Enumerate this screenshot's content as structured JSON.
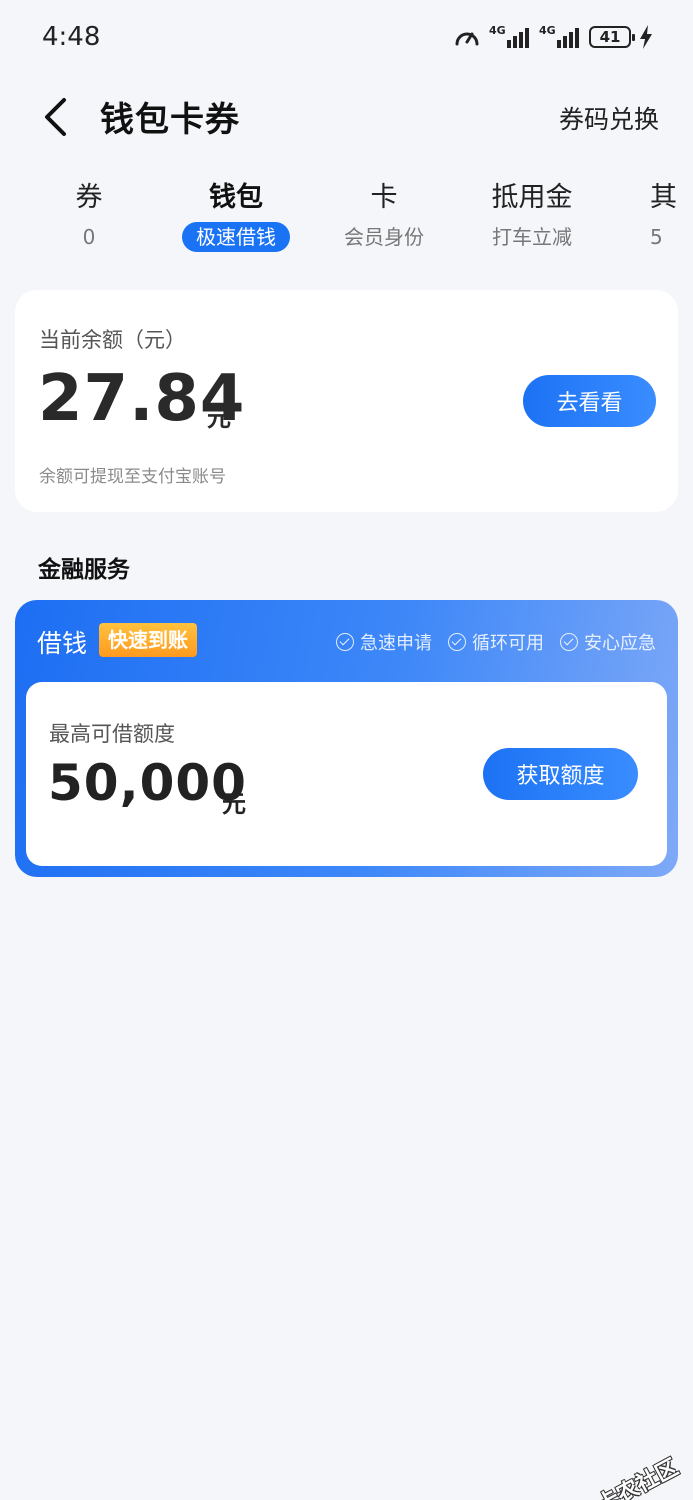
{
  "status_bar": {
    "time": "4:48",
    "signal1_label": "4G",
    "signal2_label": "4G",
    "battery": "41"
  },
  "header": {
    "title": "钱包卡券",
    "redeem": "券码兑换"
  },
  "tabs": [
    {
      "label": "券",
      "sub": "0"
    },
    {
      "label": "钱包",
      "sub": "极速借钱",
      "active": true
    },
    {
      "label": "卡",
      "sub": "会员身份"
    },
    {
      "label": "抵用金",
      "sub": "打车立减"
    },
    {
      "label": "其",
      "sub": "5"
    }
  ],
  "balance": {
    "label": "当前余额（元）",
    "amount": "27.84",
    "unit": "元",
    "button": "去看看",
    "note": "余额可提现至支付宝账号"
  },
  "finance": {
    "section_title": "金融服务",
    "loan_title": "借钱",
    "badge": "快速到账",
    "features": [
      "急速申请",
      "循环可用",
      "安心应急"
    ],
    "limit_label": "最高可借额度",
    "limit_amount": "50,000",
    "limit_unit": "元",
    "button": "获取额度"
  },
  "watermark": {
    "text": "卡农社区"
  },
  "colors": {
    "accent": "#1a73f5",
    "background": "#f4f6fa",
    "badge": "#ff9a1f"
  }
}
